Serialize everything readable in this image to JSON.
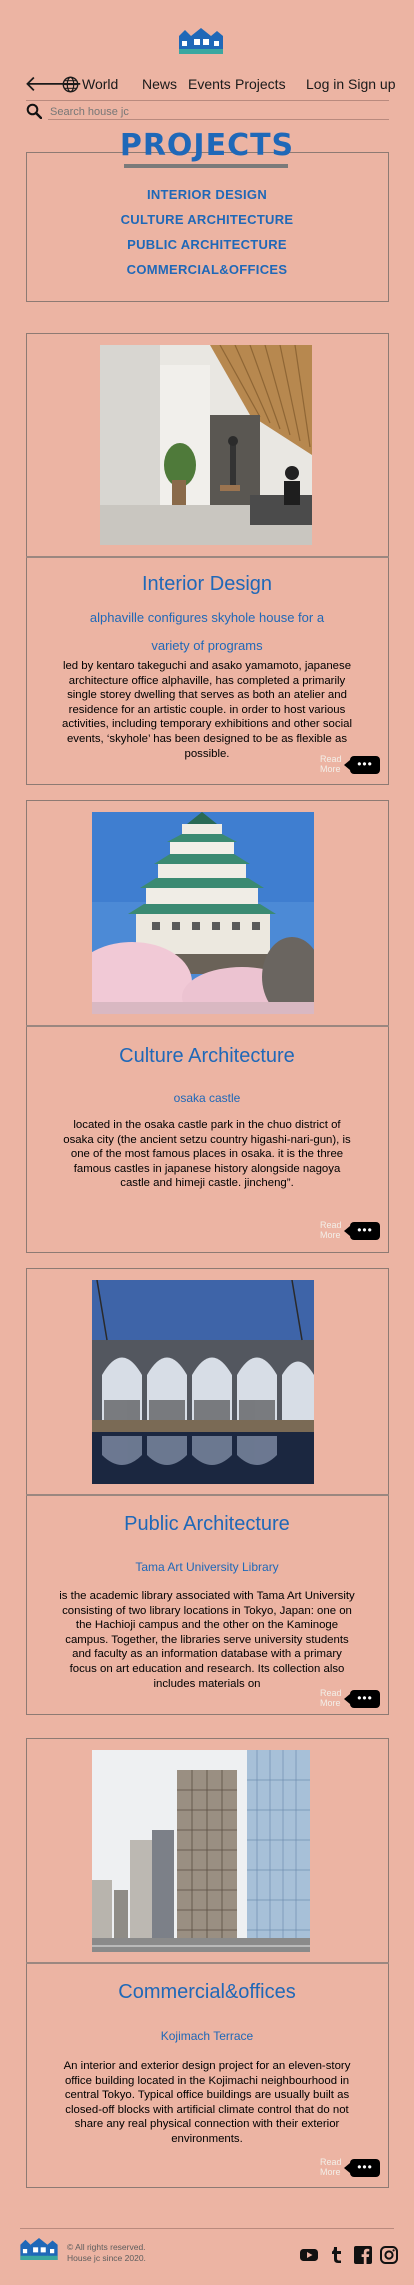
{
  "header": {
    "nav": {
      "world": "World",
      "news": "News",
      "events": "Events",
      "projects": "Projects",
      "login": "Log in",
      "signup": "Sign up"
    },
    "search_placeholder": "Search house jc",
    "icons": [
      "logo-icon",
      "back-arrow-icon",
      "globe-icon",
      "search-icon"
    ]
  },
  "page_title": "PROJECTS",
  "categories": [
    "INTERIOR DESIGN",
    "CULTURE  ARCHITECTURE",
    "PUBLIC ARCHITECTURE",
    "COMMERCIAL&OFFICES"
  ],
  "cards": [
    {
      "title": "Interior Design",
      "subtitle_1": "alphaville configures skyhole house for a",
      "subtitle_2": "variety of programs",
      "body": "led by kentaro takeguchi and asako yamamoto, japanese architecture office alphaville, has completed a primarily single storey dwelling that serves as both an atelier and residence for an artistic couple. in order to host various activities, including temporary exhibitions and other social events, ‘skyhole’ has been designed to be as flexible as possible.",
      "read_more": "Read More",
      "more_icon": "ellipsis-icon"
    },
    {
      "title": "Culture  Architecture",
      "subtitle": "osaka castle",
      "body": "located in the osaka castle park in the chuo district of osaka city (the ancient setzu country higashi-nari-gun), is one of the most famous places in osaka. it is the three famous castles in japanese history alongside nagoya castle and himeji castle. jincheng”.",
      "read_more": "Read More",
      "more_icon": "ellipsis-icon"
    },
    {
      "title": "Public Architecture",
      "subtitle": "Tama Art University Library",
      "body": "is the academic library associated with Tama Art University consisting of two library locations in Tokyo, Japan: one on the Hachioji campus and the other on the Kaminoge campus. Together, the libraries serve university students and faculty as an information database with a primary focus on art education and research. Its collection also includes materials on",
      "read_more": "Read More",
      "more_icon": "ellipsis-icon"
    },
    {
      "title": "Commercial&offices",
      "subtitle": "Kojimach Terrace",
      "body": "An interior and exterior design project for an eleven-story office building located in the Kojimachi neighbourhood in central Tokyo. Typical office buildings are usually built as closed-off blocks with artificial climate control that do not share any real physical connection with their exterior environments.",
      "read_more": "Read More",
      "more_icon": "ellipsis-icon"
    }
  ],
  "footer": {
    "copyright": "© All rights reserved.",
    "since": "House jc since 2020.",
    "social_icons": [
      "youtube-icon",
      "tumblr-icon",
      "facebook-icon",
      "instagram-icon"
    ]
  },
  "colors": {
    "background": "#ecb4a3",
    "accent_blue": "#1f68b8",
    "text": "#000000"
  }
}
